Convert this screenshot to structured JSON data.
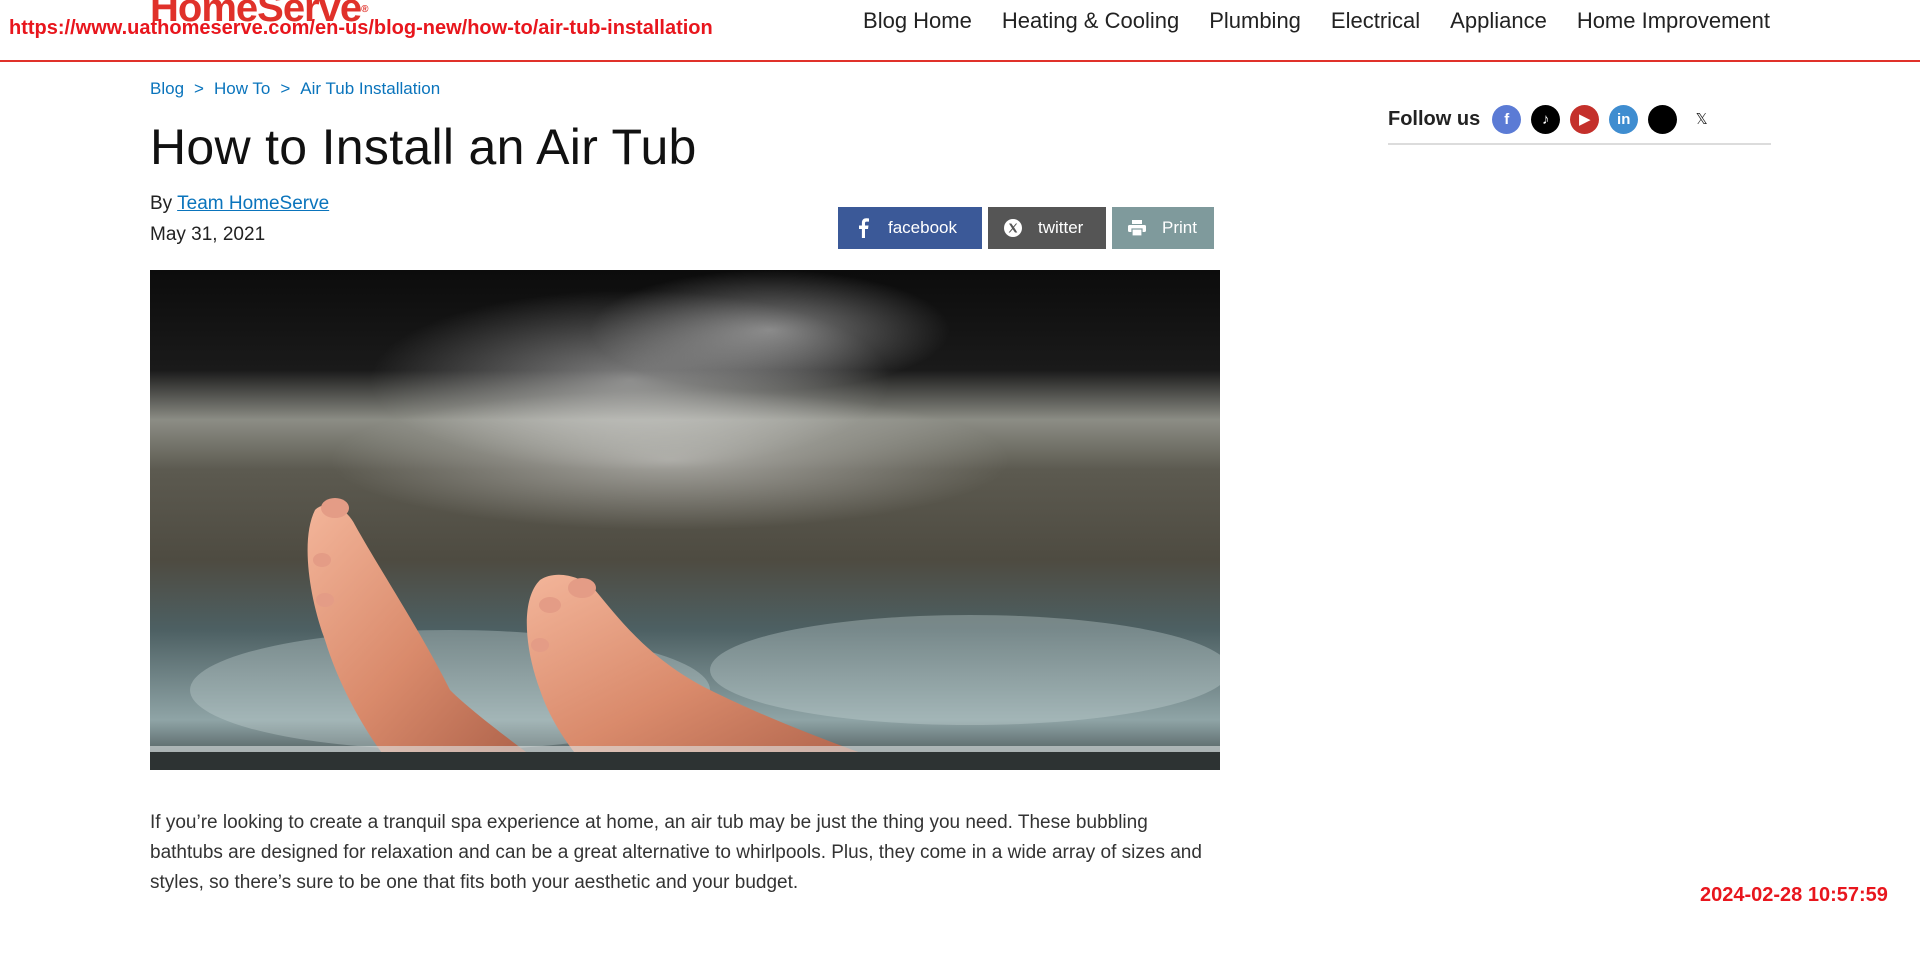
{
  "browser": {
    "url": "https://www.uathomeserve.com/en-us/blog-new/how-to/air-tub-installation",
    "timestamp": "2024-02-28 10:57:59"
  },
  "header": {
    "logo_text": "HomeServe",
    "logo_mark": "®",
    "nav": [
      {
        "label": "Blog Home"
      },
      {
        "label": "Heating & Cooling"
      },
      {
        "label": "Plumbing"
      },
      {
        "label": "Electrical"
      },
      {
        "label": "Appliance"
      },
      {
        "label": "Home Improvement"
      }
    ]
  },
  "breadcrumb": {
    "items": [
      {
        "label": "Blog"
      },
      {
        "label": "How To"
      },
      {
        "label": "Air Tub Installation"
      }
    ],
    "separator": ">"
  },
  "article": {
    "title": "How to Install an Air Tub",
    "by_prefix": "By",
    "author": "Team HomeServe",
    "date": "May 31, 2021",
    "intro": "If you’re looking to create a tranquil spa experience at home, an air tub may be just the thing you need. These bubbling bathtubs are designed for relaxation and can be a great alternative to whirlpools. Plus, they come in a wide array of sizes and styles, so there’s sure to be one that fits both your aesthetic and your budget."
  },
  "share": {
    "facebook_label": "facebook",
    "twitter_label": "twitter",
    "print_label": "Print"
  },
  "sidebar": {
    "follow_label": "Follow us",
    "social": [
      {
        "icon": "facebook-icon",
        "glyph": "f",
        "color": "#5b7bd5"
      },
      {
        "icon": "tiktok-icon",
        "glyph": "♪",
        "color": "#000000"
      },
      {
        "icon": "youtube-icon",
        "glyph": "▶",
        "color": "#c4302b"
      },
      {
        "icon": "linkedin-icon",
        "glyph": "in",
        "color": "#3f8dd0"
      },
      {
        "icon": "threads-icon",
        "glyph": "",
        "color": "#000000"
      },
      {
        "icon": "x-icon",
        "glyph": "𝕏",
        "color": "#ffffff"
      }
    ]
  },
  "colors": {
    "brand_red": "#e0312a",
    "link_blue": "#0a74bc",
    "facebook": "#3b5998",
    "twitter": "#555555",
    "print": "#7f9a9c"
  }
}
